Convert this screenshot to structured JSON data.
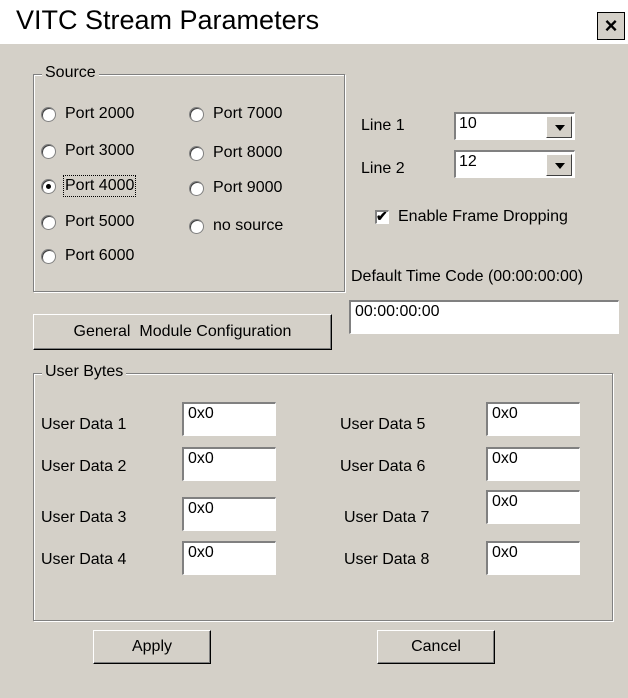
{
  "window": {
    "title": "VITC Stream Parameters",
    "close_label": "×"
  },
  "source": {
    "legend": "Source",
    "ports": [
      {
        "label": "Port 2000",
        "selected": false
      },
      {
        "label": "Port 3000",
        "selected": false
      },
      {
        "label": "Port 4000",
        "selected": true
      },
      {
        "label": "Port 5000",
        "selected": false
      },
      {
        "label": "Port 6000",
        "selected": false
      },
      {
        "label": "Port 7000",
        "selected": false
      },
      {
        "label": "Port 8000",
        "selected": false
      },
      {
        "label": "Port 9000",
        "selected": false
      },
      {
        "label": "no source",
        "selected": false
      }
    ]
  },
  "lines": {
    "line1_label": "Line 1",
    "line1_value": "10",
    "line2_label": "Line 2",
    "line2_value": "12"
  },
  "frame_dropping": {
    "label": "Enable Frame Dropping",
    "checked": true,
    "check_glyph": "✔"
  },
  "timecode": {
    "label": "Default Time Code (00:00:00:00)",
    "value": "00:00:00:00"
  },
  "general_button": "General  Module Configuration",
  "user_bytes": {
    "legend": "User Bytes",
    "items": [
      {
        "label": "User Data 1",
        "value": "0x0"
      },
      {
        "label": "User Data 2",
        "value": "0x0"
      },
      {
        "label": "User Data 3",
        "value": "0x0"
      },
      {
        "label": "User Data 4",
        "value": "0x0"
      },
      {
        "label": "User Data 5",
        "value": "0x0"
      },
      {
        "label": "User Data 6",
        "value": "0x0"
      },
      {
        "label": "User Data 7",
        "value": "0x0"
      },
      {
        "label": "User Data 8",
        "value": "0x0"
      }
    ]
  },
  "buttons": {
    "apply": "Apply",
    "cancel": "Cancel"
  }
}
